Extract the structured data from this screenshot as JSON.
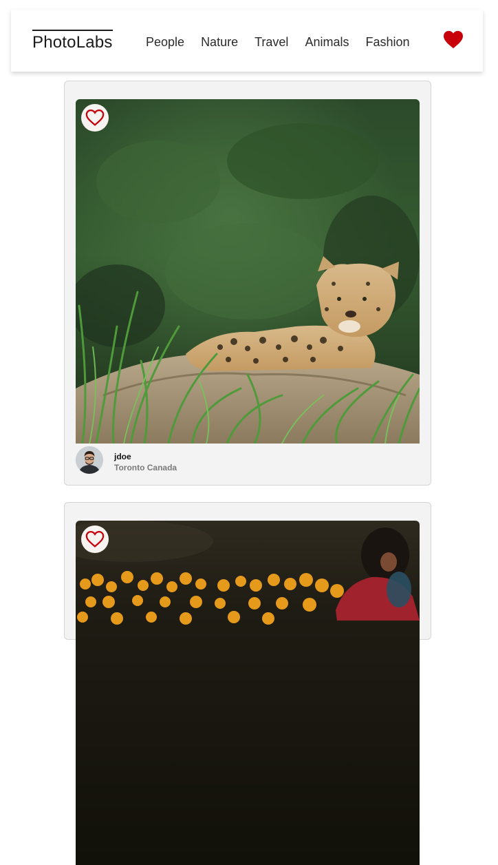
{
  "brand": {
    "name": "PhotoLabs"
  },
  "nav": {
    "topics": [
      "People",
      "Nature",
      "Travel",
      "Animals",
      "Fashion"
    ],
    "favorites_icon": "heart-filled-icon"
  },
  "colors": {
    "heart": "#c8000a",
    "card_background": "#f3f3f3",
    "location_text": "#7a7a7a"
  },
  "photos": [
    {
      "subject": "jaguar",
      "like_icon": "heart-outline-icon",
      "liked": false,
      "user": {
        "username": "jdoe",
        "location": "Toronto Canada"
      }
    },
    {
      "subject": "marigold-field",
      "like_icon": "heart-outline-icon",
      "liked": false
    }
  ]
}
